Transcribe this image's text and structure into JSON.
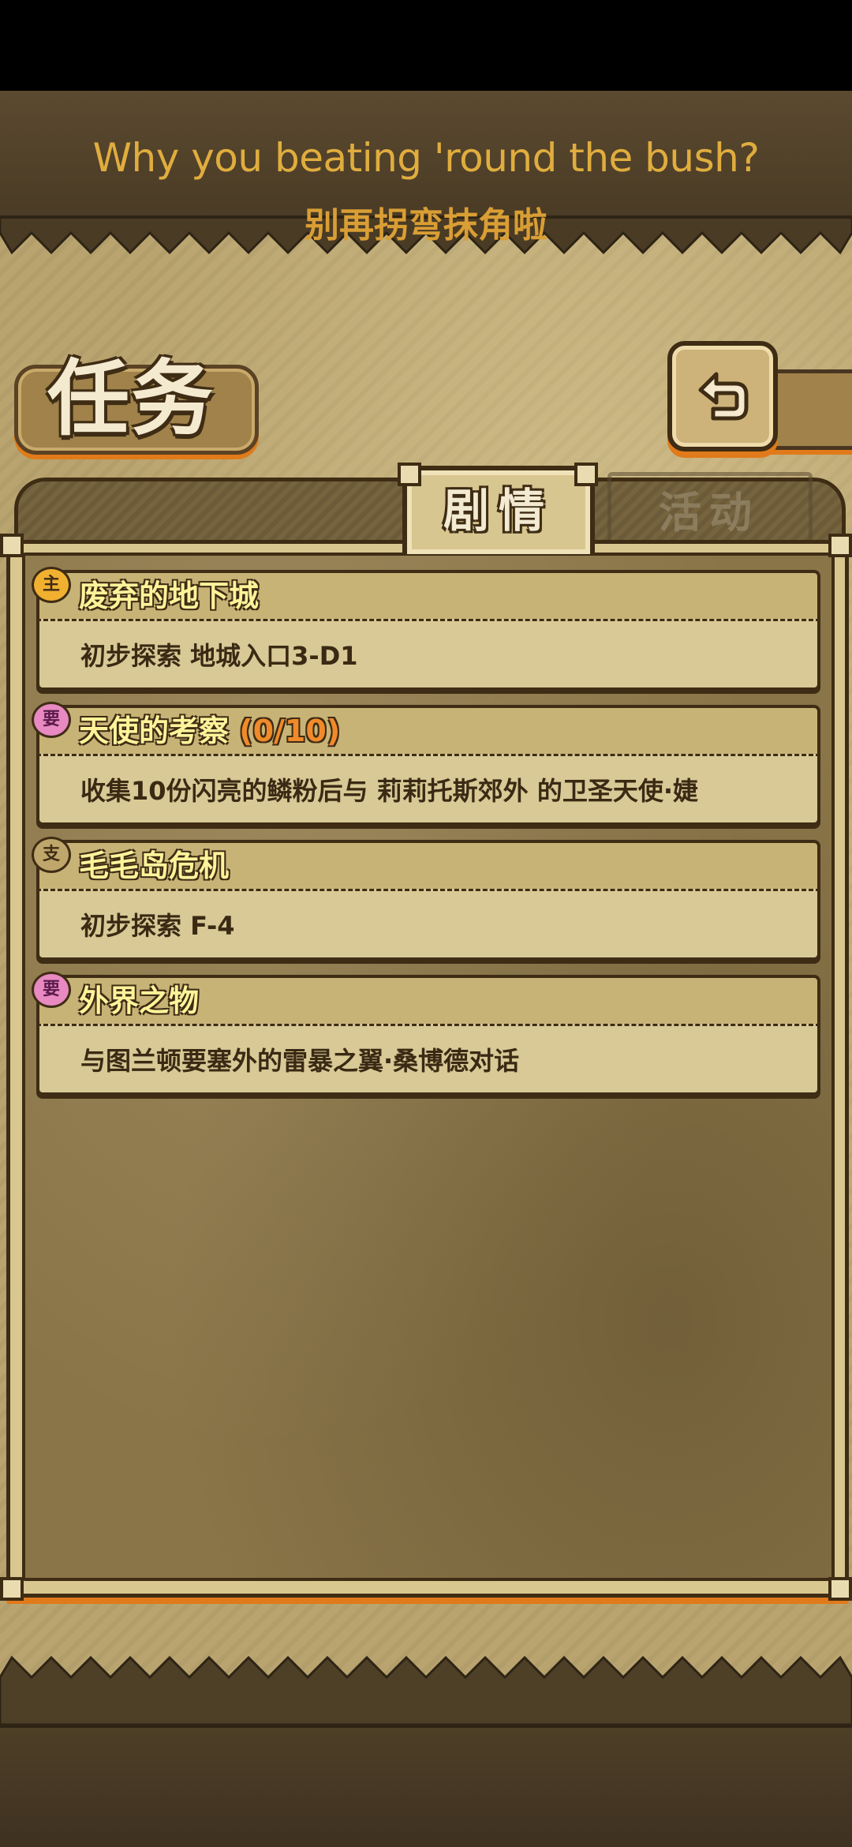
{
  "caption": {
    "english": "Why you beating 'round the bush?",
    "chinese": "别再拐弯抹角啦"
  },
  "header": {
    "title": "任务",
    "back_icon": "back-arrow-icon"
  },
  "tabs": [
    {
      "label": "剧情",
      "active": true
    },
    {
      "label": "活动",
      "active": false
    }
  ],
  "quests": [
    {
      "tag": "主",
      "tag_type": "main",
      "title": "废弃的地下城",
      "progress": "",
      "description": "初步探索 地城入口3-D1"
    },
    {
      "tag": "要",
      "tag_type": "required",
      "title": "天使的考察",
      "progress": "(0/10)",
      "description": "收集10份闪亮的鳞粉后与 莉莉托斯郊外 的卫圣天使·婕"
    },
    {
      "tag": "支",
      "tag_type": "side",
      "title": "毛毛岛危机",
      "progress": "",
      "description": "初步探索 F-4"
    },
    {
      "tag": "要",
      "tag_type": "required",
      "title": "外界之物",
      "progress": "",
      "description": "与图兰顿要塞外的雷暴之翼·桑博德对话"
    }
  ],
  "colors": {
    "caption_gold": "#e0ad3e",
    "accent_orange": "#e07a1a",
    "quest_title_yellow": "#fff39a",
    "progress_orange": "#f08a2a",
    "outline_brown": "#3e2c14"
  }
}
